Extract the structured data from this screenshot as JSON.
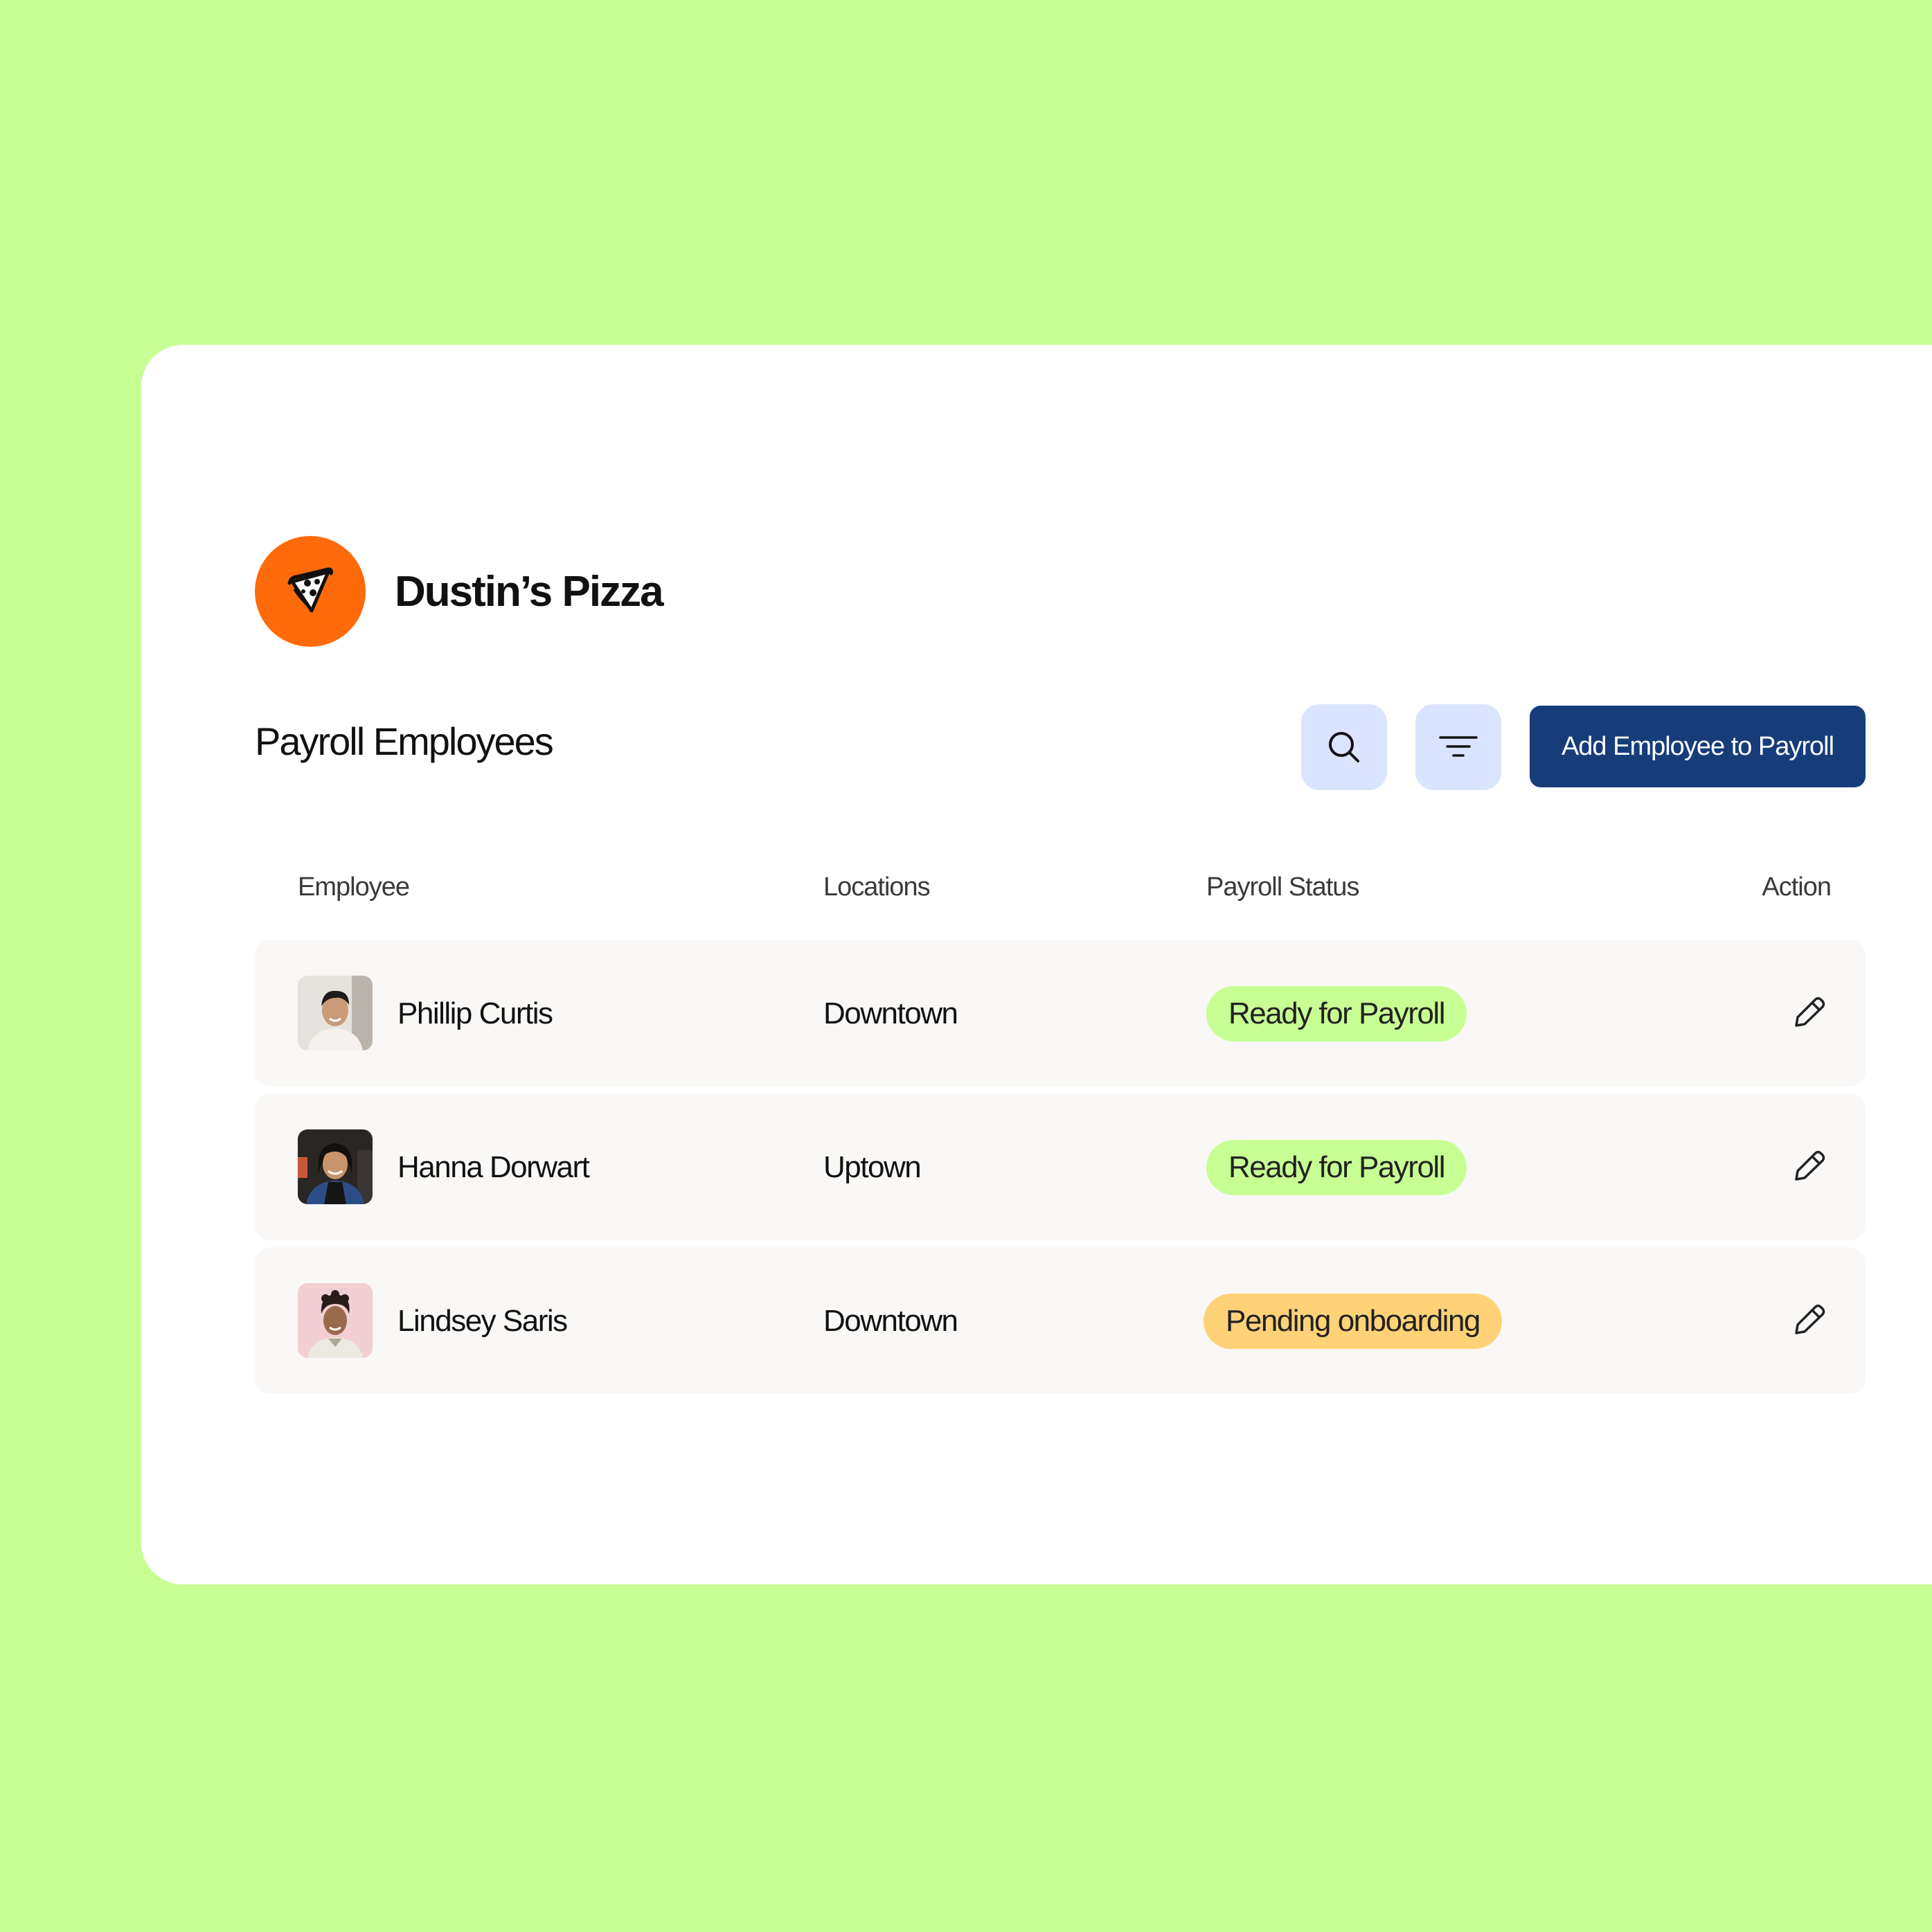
{
  "brand": {
    "name": "Dustin’s Pizza",
    "logo_icon": "pizza-slice-icon",
    "logo_color": "#ff6a0a"
  },
  "section": {
    "title": "Payroll Employees"
  },
  "toolbar": {
    "search_icon": "search-icon",
    "filter_icon": "filter-icon",
    "add_label": "Add Employee to Payroll"
  },
  "table": {
    "columns": [
      "Employee",
      "Locations",
      "Payroll Status",
      "Action"
    ],
    "rows": [
      {
        "name": "Phillip Curtis",
        "location": "Downtown",
        "status": "Ready for Payroll",
        "status_kind": "ready",
        "avatar_icon": "avatar-photo"
      },
      {
        "name": "Hanna Dorwart",
        "location": "Uptown",
        "status": "Ready for Payroll",
        "status_kind": "ready",
        "avatar_icon": "avatar-photo"
      },
      {
        "name": "Lindsey Saris",
        "location": "Downtown",
        "status": "Pending onboarding",
        "status_kind": "pending",
        "avatar_icon": "avatar-photo"
      }
    ],
    "action_icon": "pencil-edit-icon"
  },
  "colors": {
    "background": "#c8ff94",
    "primary_button": "#163c7a",
    "icon_button": "#dbe4ff",
    "status_ready": "#c8ff94",
    "status_pending": "#ffd277"
  }
}
